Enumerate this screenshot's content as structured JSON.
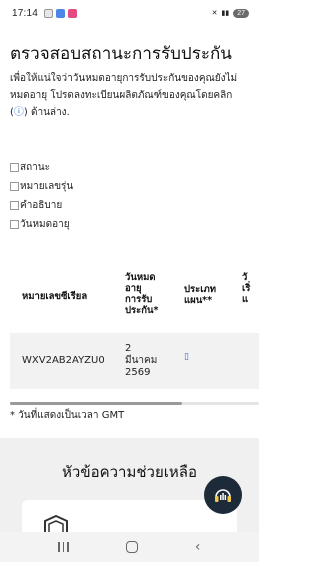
{
  "status_bar": {
    "time": "17:14",
    "battery": "27"
  },
  "page": {
    "title": "ตรวจสอบสถานะการรับประกัน",
    "intro_line1": "เพื่อให้แน่ใจว่าวันหมดอายุการรับประกันของคุณยังไม่",
    "intro_line2": "หมดอายุ โปรดลงทะเบียนผลิตภัณฑ์ของคุณโดยคลิก",
    "intro_icon": "ⓘ",
    "intro_line3_suffix": " ด้านล่าง."
  },
  "filters": [
    {
      "label": "สถานะ"
    },
    {
      "label": "หมายเลขรุ่น"
    },
    {
      "label": "คำอธิบาย"
    },
    {
      "label": "วันหมดอายุ"
    }
  ],
  "table": {
    "headers": {
      "serial": "หมายเลขซีเรียล",
      "expiry": "วันหมด\nอายุ\nการรับ\nประกัน*",
      "type": "ประเภท\nแผน**",
      "extra": "วั\nเริ่\nแ"
    },
    "rows": [
      {
        "serial": "WXV2AB2AYZU0",
        "expiry": "2\nมีนาคม\n2569",
        "type_icon": "▯"
      }
    ]
  },
  "footnote": "* วันที่แสดงเป็นเวลา GMT",
  "help": {
    "title": "หัวข้อความช่วยเหลือ"
  }
}
